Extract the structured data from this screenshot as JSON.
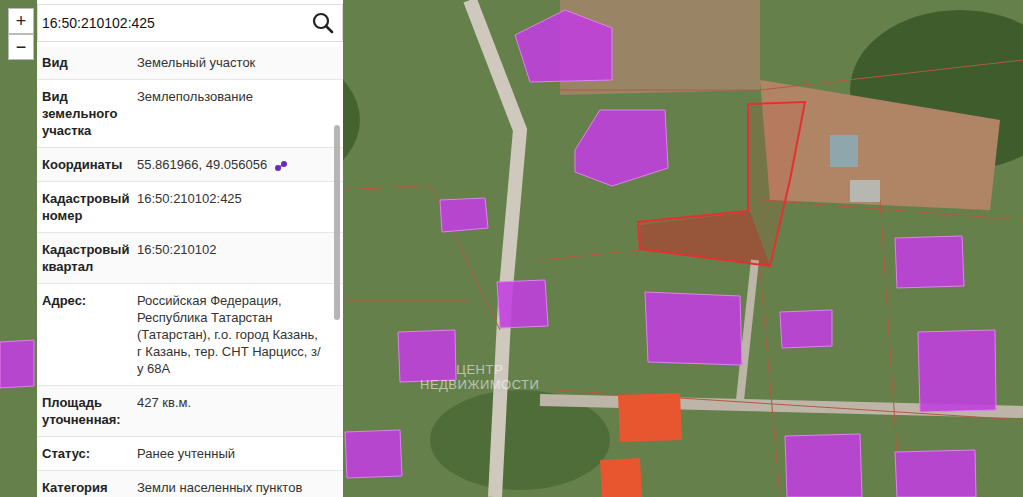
{
  "search": {
    "value": "16:50:210102:425"
  },
  "zoom": {
    "in": "+",
    "out": "−"
  },
  "info": {
    "rows": [
      {
        "label": "Вид",
        "value": "Земельный участок"
      },
      {
        "label": "Вид земельного участка",
        "value": "Землепользование"
      },
      {
        "label": "Координаты",
        "value": "55.861966, 49.056056"
      },
      {
        "label": "Кадастровый номер",
        "value": "16:50:210102:425"
      },
      {
        "label": "Кадастровый квартал",
        "value": "16:50:210102"
      },
      {
        "label": "Адрес:",
        "value": "Российская Федерация, Республика Татарстан (Татарстан), г.о. город Казань, г Казань, тер. СНТ Нарцисс, з/у 68А"
      },
      {
        "label": "Площадь уточненная:",
        "value": "427 кв.м."
      },
      {
        "label": "Статус:",
        "value": "Ранее учтенный"
      },
      {
        "label": "Категория",
        "value": "Земли населенных пунктов"
      }
    ]
  },
  "watermark": {
    "lines": [
      "ЦЕНТР",
      "НЕДВИЖИМОСТИ"
    ]
  }
}
